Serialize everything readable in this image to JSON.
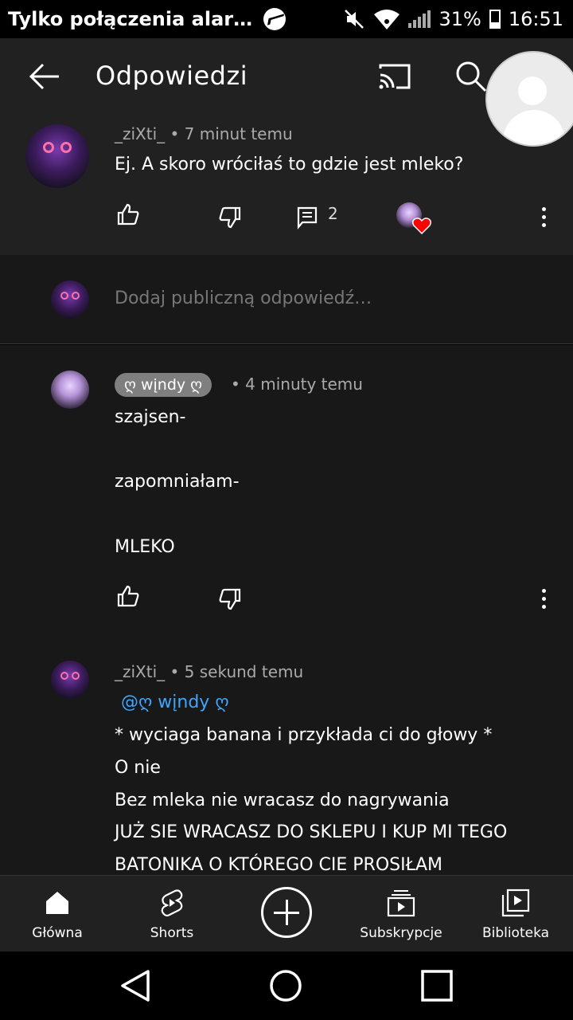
{
  "status_bar": {
    "notification_text": "Tylko połączenia alar…",
    "battery": "31%",
    "time": "16:51"
  },
  "header": {
    "title": "Odpowiedzi"
  },
  "main_comment": {
    "author": "_ziXti_",
    "time": "• 7 minut temu",
    "text": "Ej. A skoro wróciłaś to gdzie jest mleko?",
    "reply_count": "2"
  },
  "add_reply": {
    "placeholder": "Dodaj publiczną odpowiedź…"
  },
  "replies": [
    {
      "author": "ღ wįndy ღ",
      "time": "• 4 minuty temu",
      "lines": [
        "szajsen-",
        "",
        "zapomniałam-",
        "",
        "MLEKO"
      ]
    },
    {
      "author": "_ziXti_",
      "time": "• 5 sekund temu",
      "mention": "@ღ wįndy ღ",
      "lines": [
        "* wyciaga banana i przykłada ci do głowy *",
        "O nie",
        "Bez mleka nie wracasz do nagrywania",
        "JUŻ SIE WRACASZ DO SKLEPU I KUP MI TEGO",
        "BATONIKA O KTÓREGO CIE PROSIŁAM"
      ]
    }
  ],
  "bottom_nav": {
    "home": "Główna",
    "shorts": "Shorts",
    "subscriptions": "Subskrypcje",
    "library": "Biblioteka"
  },
  "colors": {
    "background": "#181818",
    "surface": "#212121",
    "mention": "#3ea6ff",
    "heart": "#ff0000"
  }
}
